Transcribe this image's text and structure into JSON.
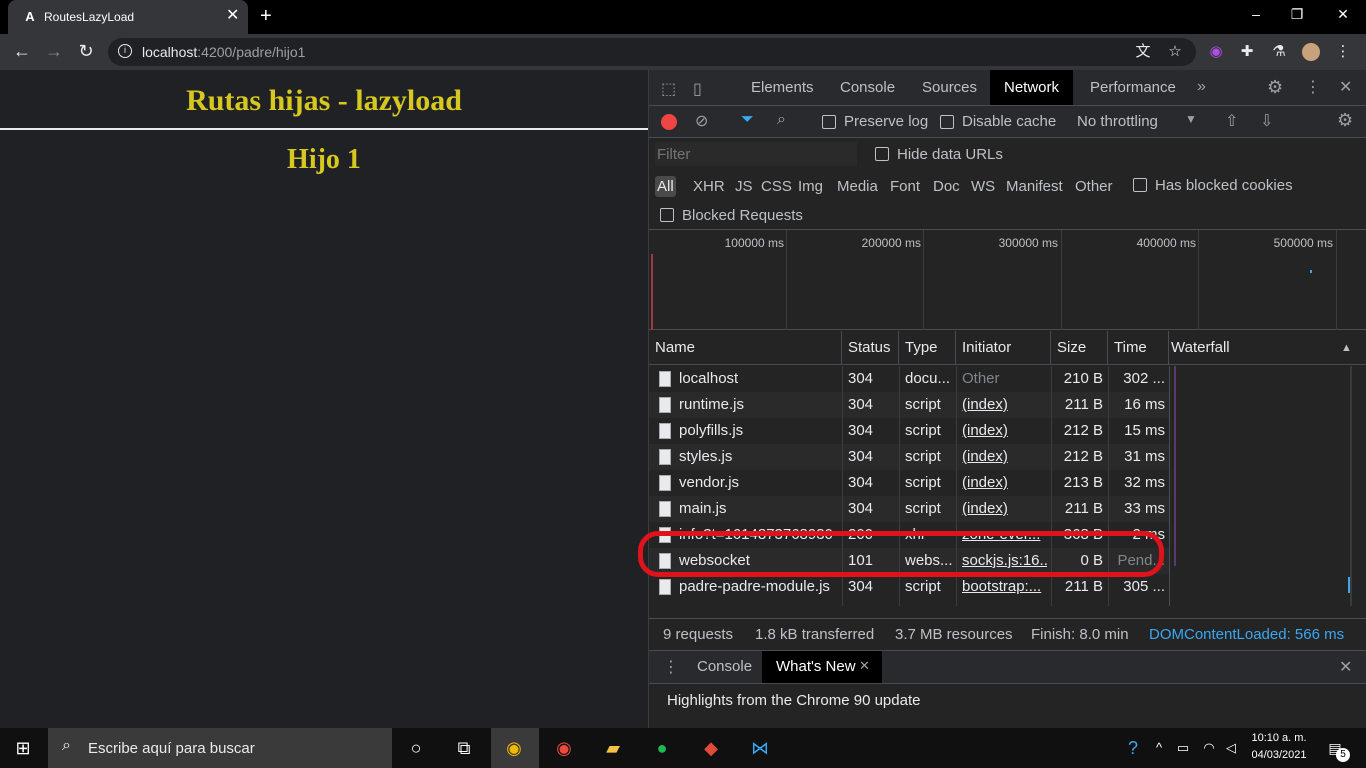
{
  "browser": {
    "tab_title": "RoutesLazyLoad",
    "tab_icon": "A",
    "url_host": "localhost",
    "url_rest": ":4200/padre/hijo1"
  },
  "page": {
    "heading": "Rutas hijas - lazyload",
    "subheading": "Hijo 1"
  },
  "devtools": {
    "tabs": [
      "Elements",
      "Console",
      "Sources",
      "Network",
      "Performance"
    ],
    "active_tab": "Network",
    "controls": {
      "preserve_log": "Preserve log",
      "disable_cache": "Disable cache",
      "throttling": "No throttling"
    },
    "filter": {
      "placeholder": "Filter",
      "hide_data_urls": "Hide data URLs",
      "types": [
        "All",
        "XHR",
        "JS",
        "CSS",
        "Img",
        "Media",
        "Font",
        "Doc",
        "WS",
        "Manifest",
        "Other"
      ],
      "has_blocked_cookies": "Has blocked cookies",
      "blocked_requests": "Blocked Requests"
    },
    "overview_ticks": [
      "100000 ms",
      "200000 ms",
      "300000 ms",
      "400000 ms",
      "500000 ms"
    ],
    "columns": [
      "Name",
      "Status",
      "Type",
      "Initiator",
      "Size",
      "Time",
      "Waterfall"
    ],
    "rows": [
      {
        "name": "localhost",
        "status": "304",
        "type": "docu...",
        "initiator": "Other",
        "size": "210 B",
        "time": "302 ..."
      },
      {
        "name": "runtime.js",
        "status": "304",
        "type": "script",
        "initiator": "(index)",
        "size": "211 B",
        "time": "16 ms"
      },
      {
        "name": "polyfills.js",
        "status": "304",
        "type": "script",
        "initiator": "(index)",
        "size": "212 B",
        "time": "15 ms"
      },
      {
        "name": "styles.js",
        "status": "304",
        "type": "script",
        "initiator": "(index)",
        "size": "212 B",
        "time": "31 ms"
      },
      {
        "name": "vendor.js",
        "status": "304",
        "type": "script",
        "initiator": "(index)",
        "size": "213 B",
        "time": "32 ms"
      },
      {
        "name": "main.js",
        "status": "304",
        "type": "script",
        "initiator": "(index)",
        "size": "211 B",
        "time": "33 ms"
      },
      {
        "name": "info?t=1614873768930",
        "status": "200",
        "type": "xhr",
        "initiator": "zone-ever...",
        "size": "368 B",
        "time": "2 ms"
      },
      {
        "name": "websocket",
        "status": "101",
        "type": "webs...",
        "initiator": "sockjs.js:16...",
        "size": "0 B",
        "time": "Pend..."
      },
      {
        "name": "padre-padre-module.js",
        "status": "304",
        "type": "script",
        "initiator": "bootstrap:...",
        "size": "211 B",
        "time": "305 ..."
      }
    ],
    "status": {
      "requests": "9 requests",
      "transferred": "1.8 kB transferred",
      "resources": "3.7 MB resources",
      "finish": "Finish: 8.0 min",
      "domcontentloaded": "DOMContentLoaded: 566 ms"
    },
    "drawer": {
      "tabs": [
        "Console",
        "What's New"
      ],
      "message": "Highlights from the Chrome 90 update"
    }
  },
  "taskbar": {
    "search_placeholder": "Escribe aquí para buscar",
    "time": "10:10 a. m.",
    "date": "04/03/2021",
    "notifications": "5"
  },
  "colors": {
    "heading": "#d6c81e",
    "highlight_ring": "#e0121b",
    "dcl": "#3aa7f1"
  }
}
